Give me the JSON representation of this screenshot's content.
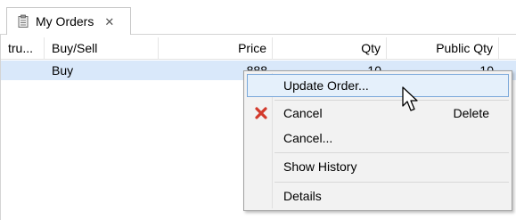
{
  "tab": {
    "title": "My Orders",
    "icon": "clipboard-icon",
    "close_glyph": "✕"
  },
  "table": {
    "columns": [
      "tru...",
      "Buy/Sell",
      "Price",
      "Qty",
      "Public Qty"
    ],
    "rows": [
      {
        "instrument": "",
        "side": "Buy",
        "price": "888",
        "qty": "10",
        "public_qty": "10"
      }
    ],
    "selected_row_color": "#d9e8fa"
  },
  "context_menu": {
    "items": [
      {
        "label": "Update Order...",
        "accel": "",
        "icon": "",
        "hover": true
      },
      {
        "label": "Cancel",
        "accel": "Delete",
        "icon": "red-x-icon",
        "hover": false
      },
      {
        "label": "Cancel...",
        "accel": "",
        "icon": "",
        "hover": false
      },
      {
        "label": "Show History",
        "accel": "",
        "icon": "",
        "hover": false
      },
      {
        "label": "Details",
        "accel": "",
        "icon": "",
        "hover": false
      }
    ],
    "hover_color": "#e5f0fb",
    "hover_border": "#7aa8da"
  },
  "colors": {
    "cancel_icon": "#d33a2c"
  }
}
